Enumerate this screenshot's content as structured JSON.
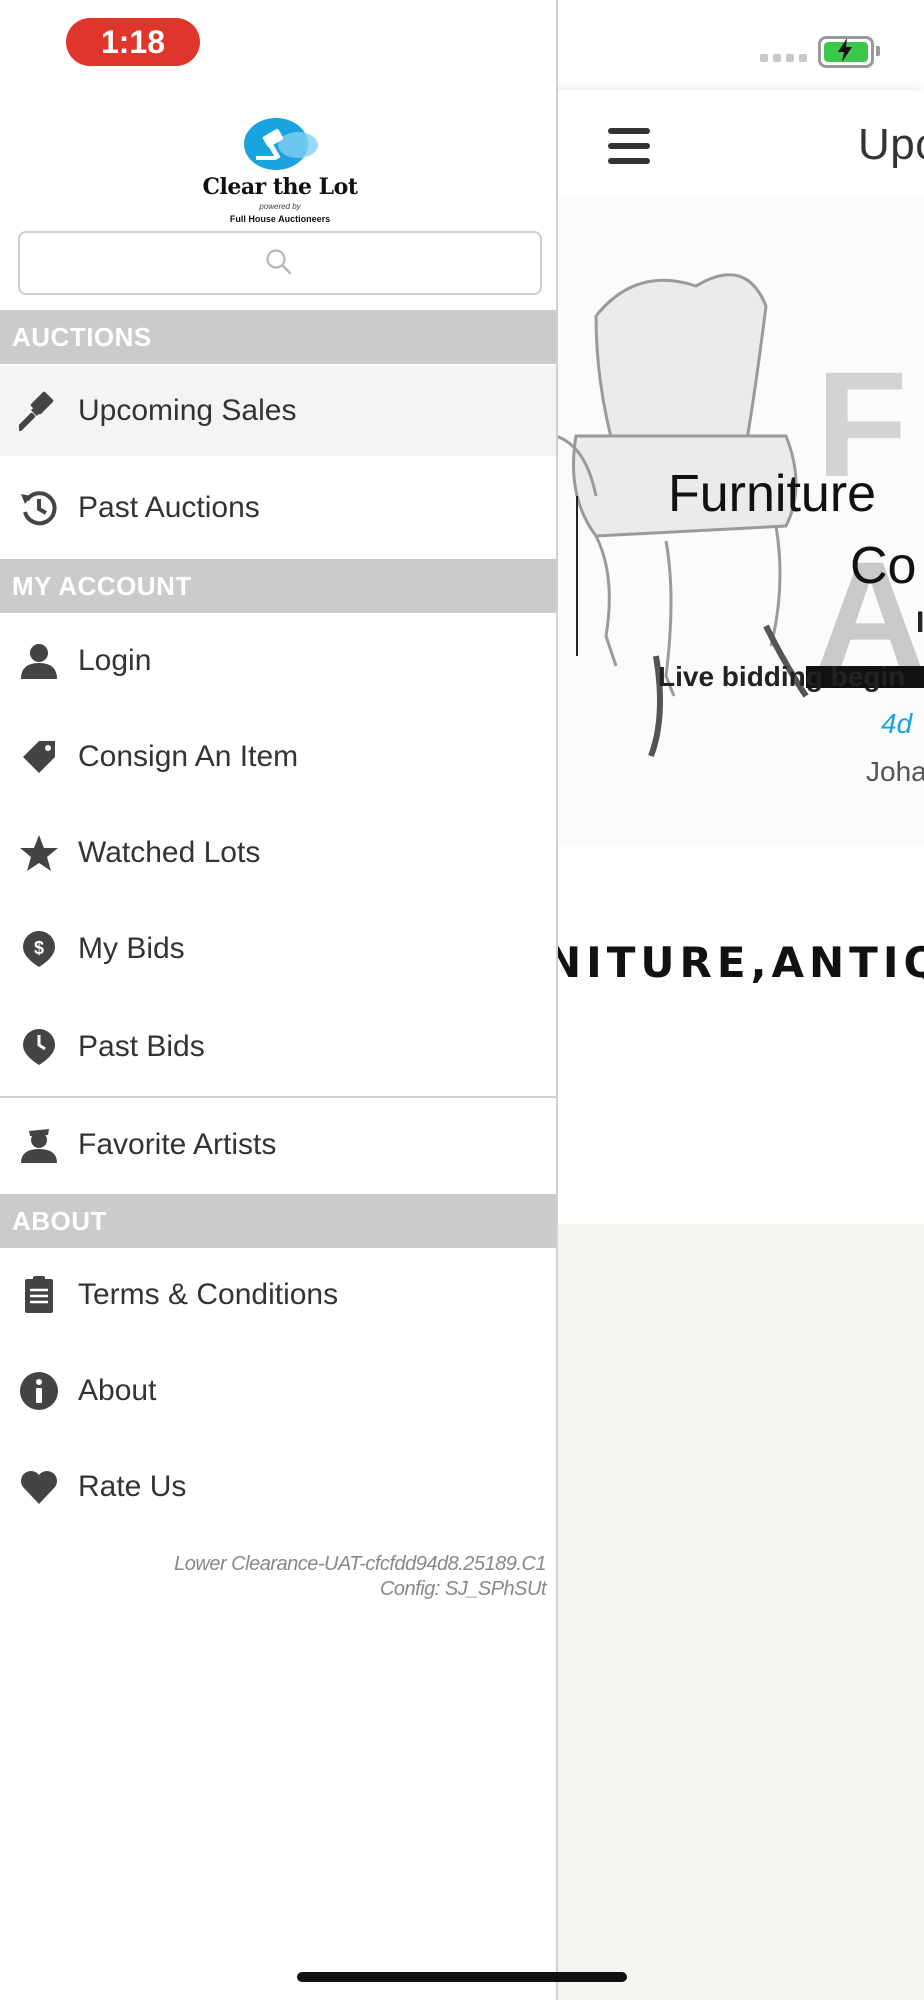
{
  "status_bar": {
    "time": "1:18",
    "time_pill_color": "#e0352b",
    "battery_color": "#3cc84a"
  },
  "drawer": {
    "logo": {
      "name": "Clear the Lot",
      "powered_by": "powered by",
      "company": "Full House Auctioneers",
      "icon": "gavel-logo-icon"
    },
    "search": {
      "placeholder": "",
      "icon": "search-icon"
    },
    "sections": {
      "auctions": "AUCTIONS",
      "my_account": "MY ACCOUNT",
      "about": "ABOUT"
    },
    "items": {
      "upcoming_sales": {
        "label": "Upcoming Sales",
        "icon": "gavel-icon"
      },
      "past_auctions": {
        "label": "Past Auctions",
        "icon": "history-icon"
      },
      "login": {
        "label": "Login",
        "icon": "user-icon"
      },
      "consign": {
        "label": "Consign An Item",
        "icon": "tag-icon"
      },
      "watched": {
        "label": "Watched Lots",
        "icon": "star-icon"
      },
      "my_bids": {
        "label": "My Bids",
        "icon": "dollar-pin-icon"
      },
      "past_bids": {
        "label": "Past Bids",
        "icon": "clock-pin-icon"
      },
      "favorite_artists": {
        "label": "Favorite Artists",
        "icon": "artist-icon"
      },
      "terms": {
        "label": "Terms & Conditions",
        "icon": "clipboard-icon"
      },
      "about": {
        "label": "About",
        "icon": "info-icon"
      },
      "rate_us": {
        "label": "Rate Us",
        "icon": "heart-icon"
      }
    },
    "version_line1": "Lower Clearance-UAT-cfcfdd94d8.25189.C1",
    "version_line2": "Config: SJ_SPhSUt"
  },
  "main": {
    "header_title": "Upc",
    "sale": {
      "title_line1": "Furniture",
      "title_line2": "Co",
      "line1": "I",
      "live_bidding": "Live bidding begin",
      "countdown": "4d",
      "location": "Joha",
      "banner_text": "NITURE,ANTIQ",
      "countdown_color": "#1aa4df"
    }
  }
}
